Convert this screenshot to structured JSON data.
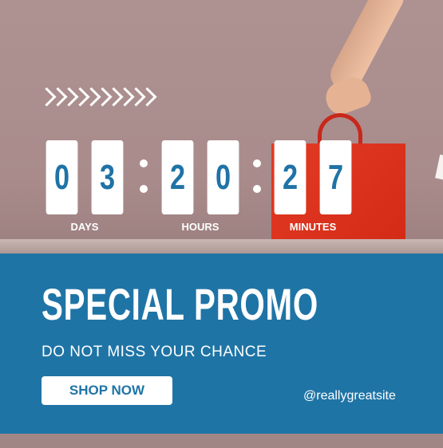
{
  "countdown": {
    "digits": [
      "0",
      "3",
      "2",
      "0",
      "2",
      "7"
    ],
    "units": {
      "days": "DAYS",
      "hours": "HOURS",
      "minutes": "MINUTES"
    }
  },
  "promo": {
    "title": "SPECIAL PROMO",
    "subtitle": "DO NOT MISS YOUR CHANCE",
    "cta_label": "SHOP NOW",
    "handle": "@reallygreatsite"
  },
  "colors": {
    "accent_blue": "#1f74a6",
    "background_mauve": "#ae9292",
    "bag_red": "#e23b24"
  },
  "icons": {
    "chevrons": "double-chevron-right-icon"
  }
}
